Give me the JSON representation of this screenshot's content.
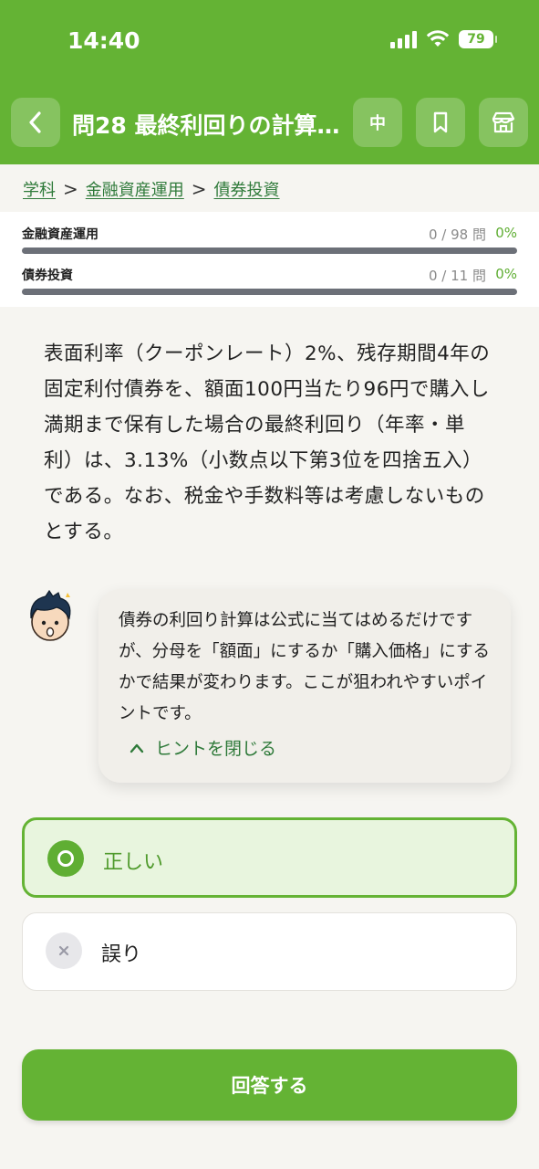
{
  "status_bar": {
    "time": "14:40",
    "battery": "79"
  },
  "header": {
    "title": "問28 最終利回りの計算…",
    "level": "中"
  },
  "breadcrumb": {
    "items": [
      "学科",
      "金融資産運用",
      "債券投資"
    ],
    "separator": ">"
  },
  "progress": [
    {
      "label": "金融資産運用",
      "count": "0 / 98 問",
      "percent": "0%",
      "fraction": 0
    },
    {
      "label": "債券投資",
      "count": "0 / 11 問",
      "percent": "0%",
      "fraction": 0
    }
  ],
  "question": {
    "text": "表面利率（クーポンレート）2%、残存期間4年の固定利付債券を、額面100円当たり96円で購入し満期まで保有した場合の最終利回り（年率・単利）は、3.13%（小数点以下第3位を四捨五入）である。なお、税金や手数料等は考慮しないものとする。"
  },
  "hint": {
    "text": "債券の利回り計算は公式に当てはめるだけですが、分母を「額面」にするか「購入価格」にするかで結果が変わります。ここが狙われやすいポイントです。",
    "close_label": "ヒントを閉じる"
  },
  "options": [
    {
      "label": "正しい",
      "selected": true
    },
    {
      "label": "誤り",
      "selected": false
    }
  ],
  "submit_label": "回答する",
  "colors": {
    "brand": "#64b334",
    "link": "#2f7a3a",
    "background": "#f6f5f1"
  },
  "icons": {
    "back": "chevron-left-icon",
    "bookmark": "bookmark-icon",
    "store": "store-icon",
    "hint_close": "chevron-up-icon",
    "correct": "circle-icon",
    "wrong": "x-icon"
  }
}
